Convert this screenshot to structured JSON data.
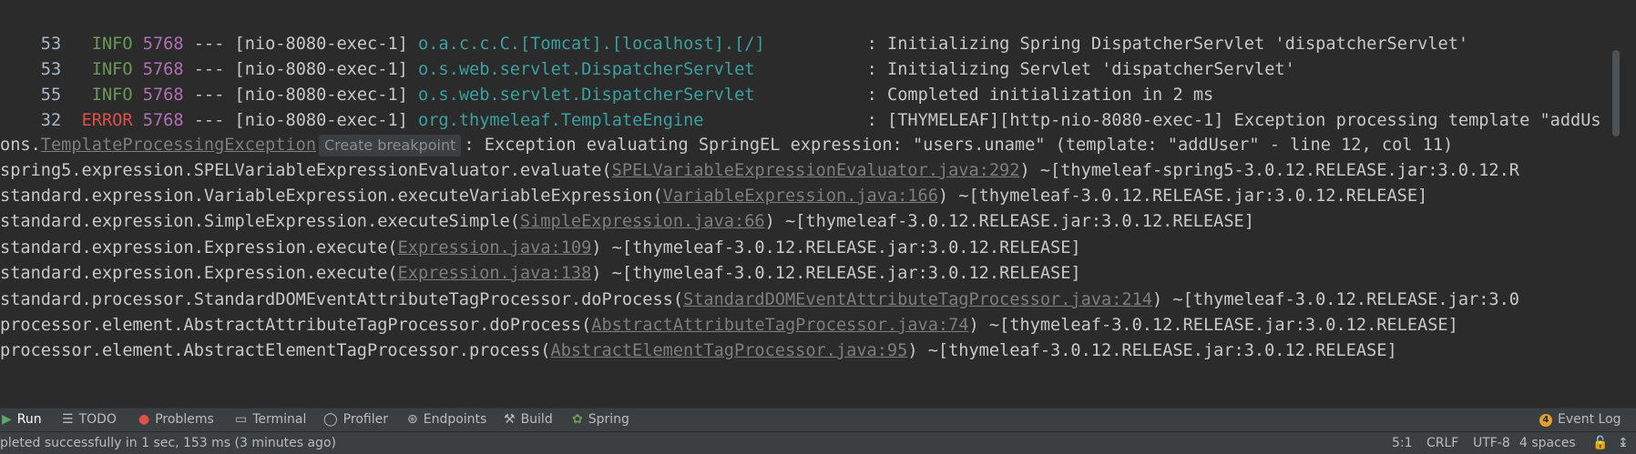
{
  "log_lines": [
    {
      "num": "53",
      "level": "INFO",
      "pid": "5768",
      "sep": "---",
      "thread": "[nio-8080-exec-1]",
      "logger": "o.a.c.c.C.[Tomcat].[localhost].[/]",
      "message": ": Initializing Spring DispatcherServlet 'dispatcherServlet'"
    },
    {
      "num": "53",
      "level": "INFO",
      "pid": "5768",
      "sep": "---",
      "thread": "[nio-8080-exec-1]",
      "logger": "o.s.web.servlet.DispatcherServlet",
      "message": ": Initializing Servlet 'dispatcherServlet'"
    },
    {
      "num": "55",
      "level": "INFO",
      "pid": "5768",
      "sep": "---",
      "thread": "[nio-8080-exec-1]",
      "logger": "o.s.web.servlet.DispatcherServlet",
      "message": ": Completed initialization in 2 ms"
    },
    {
      "num": "32",
      "level": "ERROR",
      "pid": "5768",
      "sep": "---",
      "thread": "[nio-8080-exec-1]",
      "logger": "org.thymeleaf.TemplateEngine",
      "message": ": [THYMELEAF][http-nio-8080-exec-1] Exception processing template \"addUs"
    }
  ],
  "exception": {
    "prefix": "ons.",
    "class_link": "TemplateProcessingException",
    "breakpoint_label": "Create breakpoint",
    "message": ": Exception evaluating SpringEL expression: \"users.uname\" (template: \"addUser\" - line 12, col 11)"
  },
  "stack": [
    {
      "before": "spring5.expression.SPELVariableExpressionEvaluator.evaluate(",
      "link": "SPELVariableExpressionEvaluator.java:292",
      "after": ") ~[thymeleaf-spring5-3.0.12.RELEASE.jar:3.0.12.R"
    },
    {
      "before": "standard.expression.VariableExpression.executeVariableExpression(",
      "link": "VariableExpression.java:166",
      "after": ") ~[thymeleaf-3.0.12.RELEASE.jar:3.0.12.RELEASE]"
    },
    {
      "before": "standard.expression.SimpleExpression.executeSimple(",
      "link": "SimpleExpression.java:66",
      "after": ") ~[thymeleaf-3.0.12.RELEASE.jar:3.0.12.RELEASE]"
    },
    {
      "before": "standard.expression.Expression.execute(",
      "link": "Expression.java:109",
      "after": ") ~[thymeleaf-3.0.12.RELEASE.jar:3.0.12.RELEASE]"
    },
    {
      "before": "standard.expression.Expression.execute(",
      "link": "Expression.java:138",
      "after": ") ~[thymeleaf-3.0.12.RELEASE.jar:3.0.12.RELEASE]"
    },
    {
      "before": "standard.processor.StandardDOMEventAttributeTagProcessor.doProcess(",
      "link": "StandardDOMEventAttributeTagProcessor.java:214",
      "after": ") ~[thymeleaf-3.0.12.RELEASE.jar:3.0"
    },
    {
      "before": "processor.element.AbstractAttributeTagProcessor.doProcess(",
      "link": "AbstractAttributeTagProcessor.java:74",
      "after": ") ~[thymeleaf-3.0.12.RELEASE.jar:3.0.12.RELEASE]"
    },
    {
      "before": "processor.element.AbstractElementTagProcessor.process(",
      "link": "AbstractElementTagProcessor.java:95",
      "after": ") ~[thymeleaf-3.0.12.RELEASE.jar:3.0.12.RELEASE]"
    }
  ],
  "toolwindows": {
    "run": "Run",
    "todo": "TODO",
    "problems": "Problems",
    "terminal": "Terminal",
    "profiler": "Profiler",
    "endpoints": "Endpoints",
    "build": "Build",
    "spring": "Spring",
    "event_log": "Event Log",
    "event_log_count": "4"
  },
  "status": {
    "message": "pleted successfully in 1 sec, 153 ms (3 minutes ago)",
    "position": "5:1",
    "line_sep": "CRLF",
    "encoding": "UTF-8",
    "indent": "4 spaces"
  },
  "colors": {
    "background": "#2b2b2b",
    "info": "#6a9955",
    "error": "#e0504a",
    "logger": "#3aa0a0",
    "link": "#7e7e7e"
  }
}
